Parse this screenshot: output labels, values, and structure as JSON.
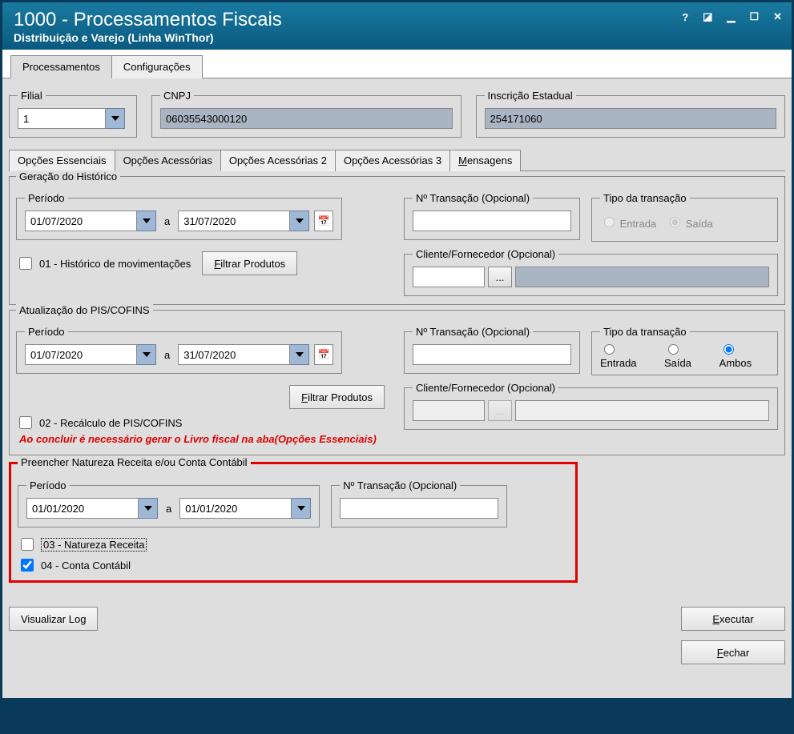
{
  "window": {
    "title": "1000 - Processamentos Fiscais",
    "subtitle": "Distribuição e Varejo (Linha WinThor)"
  },
  "top_tabs": {
    "processamentos": "Processamentos",
    "configuracoes": "Configurações"
  },
  "header_fields": {
    "filial_label": "Filial",
    "filial_value": "1",
    "cnpj_label": "CNPJ",
    "cnpj_value": "06035543000120",
    "insc_label": "Inscrição Estadual",
    "insc_value": "254171060"
  },
  "inner_tabs": {
    "essenciais": "Opções Essenciais",
    "acess": "Opções Acessórias",
    "acess2": "Opções Acessórias 2",
    "acess3": "Opções Acessórias 3",
    "mensagens": "Mensagens"
  },
  "labels": {
    "periodo": "Período",
    "a": "a",
    "n_trans": "Nº Transação (Opcional)",
    "n_trans_req": "Nº Transação (Opcional)",
    "tipo_trans": "Tipo da transação",
    "entrada": "Entrada",
    "saida": "Saída",
    "ambos": "Ambos",
    "cli_forn": "Cliente/Fornecedor (Opcional)",
    "filtrar": "Filtrar Produtos",
    "ellipsis": "..."
  },
  "sec1": {
    "title": "Geração do Histórico",
    "date_from": "01/07/2020",
    "date_to": "31/07/2020",
    "chk01": "01 - Histórico de movimentações"
  },
  "sec2": {
    "title": "Atualização do PIS/COFINS",
    "date_from": "01/07/2020",
    "date_to": "31/07/2020",
    "chk02": "02 - Recálculo de PIS/COFINS",
    "warn": "Ao concluir é necessário gerar o Livro fiscal na aba(Opções Essenciais)"
  },
  "sec3": {
    "title": "Preencher Natureza Receita e/ou Conta Contábil",
    "date_from": "01/01/2020",
    "date_to": "01/01/2020",
    "chk03": "03 - Natureza Receita",
    "chk04": "04 - Conta Contábil",
    "n_trans_label": "Nº Transação (Opcional)"
  },
  "footer": {
    "log": "Visualizar Log",
    "exec": "Executar",
    "fechar": "Fechar"
  }
}
